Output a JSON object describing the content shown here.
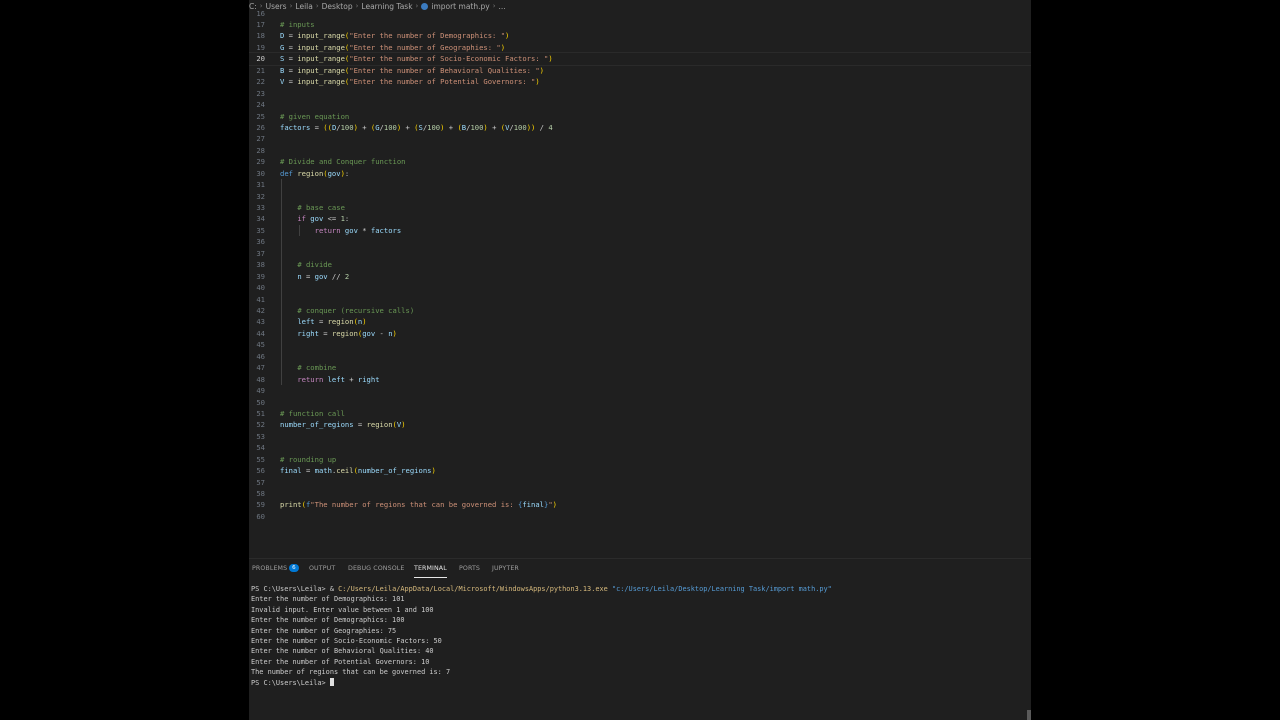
{
  "breadcrumb": {
    "items": [
      "C:",
      "Users",
      "Leila",
      "Desktop",
      "Learning Task",
      "import math.py",
      "..."
    ]
  },
  "editor": {
    "first_partial": "16",
    "active_line": "20",
    "lines": [
      {
        "n": "17",
        "c": "# inputs"
      },
      {
        "n": "18",
        "c": "D = input_range(\"Enter the number of Demographics: \")"
      },
      {
        "n": "19",
        "c": "G = input_range(\"Enter the number of Geographies: \")"
      },
      {
        "n": "20",
        "c": "S = input_range(\"Enter the number of Socio-Economic Factors: \")"
      },
      {
        "n": "21",
        "c": "B = input_range(\"Enter the number of Behavioral Qualities: \")"
      },
      {
        "n": "22",
        "c": "V = input_range(\"Enter the number of Potential Governors: \")"
      },
      {
        "n": "23",
        "c": ""
      },
      {
        "n": "24",
        "c": ""
      },
      {
        "n": "25",
        "c": "# given equation"
      },
      {
        "n": "26",
        "c": "factors = ((D/100) + (G/100) + (S/100) + (B/100) + (V/100)) / 4"
      },
      {
        "n": "27",
        "c": ""
      },
      {
        "n": "28",
        "c": ""
      },
      {
        "n": "29",
        "c": "# Divide and Conquer function"
      },
      {
        "n": "30",
        "c": "def region(gov):"
      },
      {
        "n": "31",
        "c": ""
      },
      {
        "n": "32",
        "c": ""
      },
      {
        "n": "33",
        "c": "    # base case"
      },
      {
        "n": "34",
        "c": "    if gov <= 1:"
      },
      {
        "n": "35",
        "c": "        return gov * factors"
      },
      {
        "n": "36",
        "c": ""
      },
      {
        "n": "37",
        "c": ""
      },
      {
        "n": "38",
        "c": "    # divide"
      },
      {
        "n": "39",
        "c": "    n = gov // 2"
      },
      {
        "n": "40",
        "c": ""
      },
      {
        "n": "41",
        "c": ""
      },
      {
        "n": "42",
        "c": "    # conquer (recursive calls)"
      },
      {
        "n": "43",
        "c": "    left = region(n)"
      },
      {
        "n": "44",
        "c": "    right = region(gov - n)"
      },
      {
        "n": "45",
        "c": ""
      },
      {
        "n": "46",
        "c": ""
      },
      {
        "n": "47",
        "c": "    # combine"
      },
      {
        "n": "48",
        "c": "    return left + right"
      },
      {
        "n": "49",
        "c": ""
      },
      {
        "n": "50",
        "c": ""
      },
      {
        "n": "51",
        "c": "# function call"
      },
      {
        "n": "52",
        "c": "number_of_regions = region(V)"
      },
      {
        "n": "53",
        "c": ""
      },
      {
        "n": "54",
        "c": ""
      },
      {
        "n": "55",
        "c": "# rounding up"
      },
      {
        "n": "56",
        "c": "final = math.ceil(number_of_regions)"
      },
      {
        "n": "57",
        "c": ""
      },
      {
        "n": "58",
        "c": ""
      },
      {
        "n": "59",
        "c": "print(f\"The number of regions that can be governed is: {final}\")"
      },
      {
        "n": "60",
        "c": ""
      }
    ]
  },
  "panel": {
    "tabs": [
      {
        "label": "PROBLEMS",
        "badge": "6"
      },
      {
        "label": "OUTPUT"
      },
      {
        "label": "DEBUG CONSOLE"
      },
      {
        "label": "TERMINAL",
        "active": true
      },
      {
        "label": "PORTS"
      },
      {
        "label": "JUPYTER"
      }
    ]
  },
  "terminal": {
    "prompt": "PS C:\\Users\\Leila> ",
    "cmd_amp": "& ",
    "cmd_exe": "C:/Users/Leila/AppData/Local/Microsoft/WindowsApps/python3.13.exe",
    "cmd_arg": "\"c:/Users/Leila/Desktop/Learning Task/import math.py\"",
    "output": [
      "Enter the number of Demographics: 101",
      "Invalid input. Enter value between 1 and 100",
      "Enter the number of Demographics: 100",
      "Enter the number of Geographies: 75",
      "Enter the number of Socio-Economic Factors: 50",
      "Enter the number of Behavioral Qualities: 40",
      "Enter the number of Potential Governors: 10",
      "The number of regions that can be governed is: 7"
    ],
    "final_prompt": "PS C:\\Users\\Leila> "
  },
  "colors": {
    "background": "#1f1f1f",
    "comment": "#6a9955",
    "string": "#ce9178",
    "function": "#dcdcaa",
    "variable": "#9cdcfe",
    "keyword": "#c586c0",
    "badge": "#0078d4"
  }
}
